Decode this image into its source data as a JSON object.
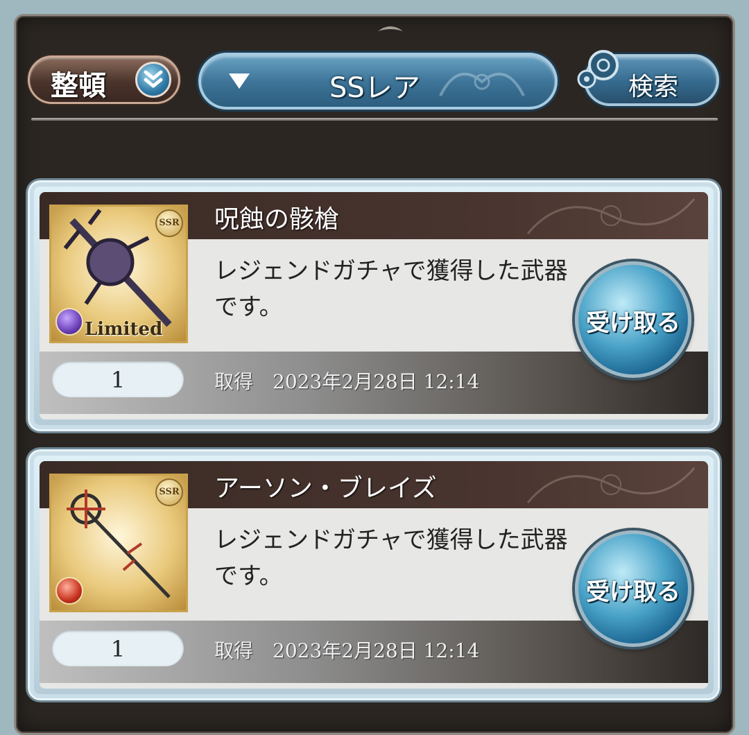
{
  "toolbar": {
    "sort_label": "整頓",
    "rarity_label": "SSレア",
    "search_label": "検索"
  },
  "items": [
    {
      "name": "呪蝕の骸槍",
      "description": "レジェンドガチャで獲得した武器です。",
      "quantity": "1",
      "acquired_label": "取得",
      "acquired_date": "2023年2月28日 12:14",
      "rarity_badge": "SSR",
      "limited_label": "Limited",
      "element_color": "#6b3fb8",
      "receive_label": "受け取る"
    },
    {
      "name": "アーソン・ブレイズ",
      "description": "レジェンドガチャで獲得した武器です。",
      "quantity": "1",
      "acquired_label": "取得",
      "acquired_date": "2023年2月28日 12:14",
      "rarity_badge": "SSR",
      "element_color": "#c8321f",
      "receive_label": "受け取る"
    }
  ]
}
